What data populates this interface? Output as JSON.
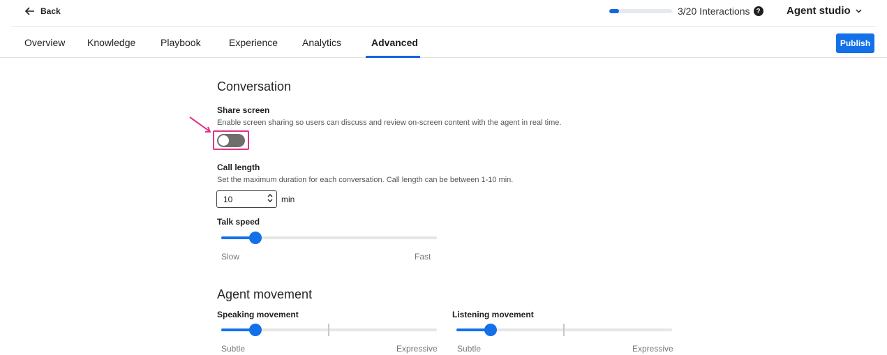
{
  "topbar": {
    "back_label": "Back",
    "interactions_label": "3/20 Interactions",
    "interactions_progress": 0.15,
    "workspace_label": "Agent studio"
  },
  "tabs": [
    {
      "label": "Overview",
      "active": false
    },
    {
      "label": "Knowledge",
      "active": false
    },
    {
      "label": "Playbook",
      "active": false
    },
    {
      "label": "Experience",
      "active": false
    },
    {
      "label": "Analytics",
      "active": false
    },
    {
      "label": "Advanced",
      "active": true
    }
  ],
  "publish_label": "Publish",
  "conversation": {
    "title": "Conversation",
    "share_screen": {
      "label": "Share screen",
      "description": "Enable screen sharing so users can discuss and review on-screen content with the agent in real time.",
      "enabled": false
    },
    "call_length": {
      "label": "Call length",
      "description": "Set the maximum duration for each conversation. Call length can be between 1-10 min.",
      "value": "10",
      "unit": "min"
    },
    "talk_speed": {
      "label": "Talk speed",
      "min_label": "Slow",
      "max_label": "Fast",
      "value": 0.13
    }
  },
  "agent_movement": {
    "title": "Agent movement",
    "speaking": {
      "label": "Speaking movement",
      "min_label": "Subtle",
      "max_label": "Expressive",
      "value": 0.13
    },
    "listening": {
      "label": "Listening movement",
      "min_label": "Subtle",
      "max_label": "Expressive",
      "value": 0.13
    }
  },
  "colors": {
    "accent": "#1270e8",
    "highlight": "#e0338a",
    "toggle_off": "#6e6e6e"
  }
}
